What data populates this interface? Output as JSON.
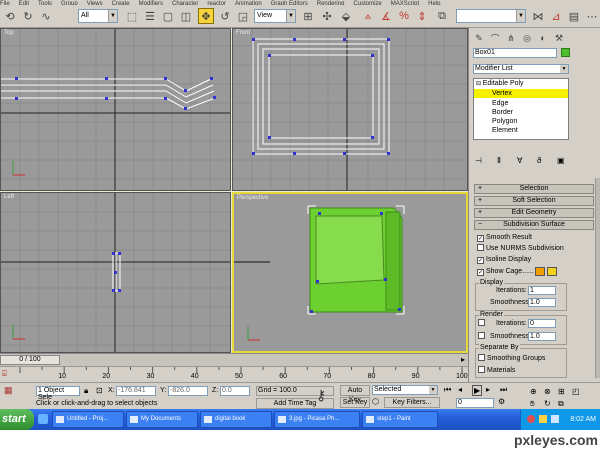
{
  "menu": [
    "File",
    "Edit",
    "Tools",
    "Group",
    "Views",
    "Create",
    "Modifiers",
    "Character",
    "reactor",
    "Animation",
    "Graph Editors",
    "Rendering",
    "Customize",
    "MAXScript",
    "Help"
  ],
  "toolbar": {
    "selection_filter": "All",
    "reference_coord": "View"
  },
  "viewports": {
    "top": "Top",
    "front": "Front",
    "left": "Left",
    "perspective": "Perspective"
  },
  "panel": {
    "object_name": "Box01",
    "modifier_list": "Modifier List",
    "stack": {
      "base": "Editable Poly",
      "items": [
        "Vertex",
        "Edge",
        "Border",
        "Polygon",
        "Element"
      ],
      "selected": "Vertex"
    },
    "rollouts": {
      "selection": "Selection",
      "soft_selection": "Soft Selection",
      "edit_geometry": "Edit Geometry",
      "subdivision_surface": "Subdivision Surface"
    },
    "subdivision": {
      "smooth_result": "Smooth Result",
      "use_nurms": "Use NURMS Subdivision",
      "isoline_display": "Isoline Display",
      "show_cage": "Show Cage......",
      "cage_color_1": "#f0a000",
      "cage_color_2": "#f2d21a",
      "display_title": "Display",
      "iterations_label": "Iterations:",
      "display_iterations": "1",
      "smoothness_label": "Smoothness:",
      "display_smoothness": "1.0",
      "render_title": "Render",
      "render_iterations": "0",
      "render_smoothness": "1.0",
      "separate_title": "Separate By",
      "smoothing_groups": "Smoothing Groups",
      "materials": "Materials"
    }
  },
  "timeline": {
    "frame_slider": "0 / 100",
    "ticks": [
      "10",
      "20",
      "30",
      "40",
      "50",
      "60",
      "70",
      "80",
      "90",
      "100"
    ]
  },
  "status": {
    "selection_info": "1 Object Sele",
    "prompt": "Click or click-and-drag to select objects",
    "x_label": "X:",
    "x_value": "-176.841",
    "y_label": "Y:",
    "y_value": "-826.0",
    "z_label": "Z:",
    "z_value": "0.0",
    "grid": "Grid = 100.0",
    "add_time_tag": "Add Time Tag",
    "auto_key": "Auto Key",
    "set_key": "Set Key",
    "key_mode": "Selected",
    "key_filters": "Key Filters...",
    "current_frame": "0"
  },
  "taskbar": {
    "start": "start",
    "tasks": [
      "Untitled - Proj...",
      "My Documents",
      "digital book",
      "3.jpg - Picasa Ph...",
      "step1 - Paint"
    ],
    "clock": "8:02 AM"
  },
  "watermark": "pxleyes.com",
  "colors": {
    "object_green": "#6bd030",
    "active_viewport": "#e6d83a",
    "selected_stack": "#f5f000"
  }
}
